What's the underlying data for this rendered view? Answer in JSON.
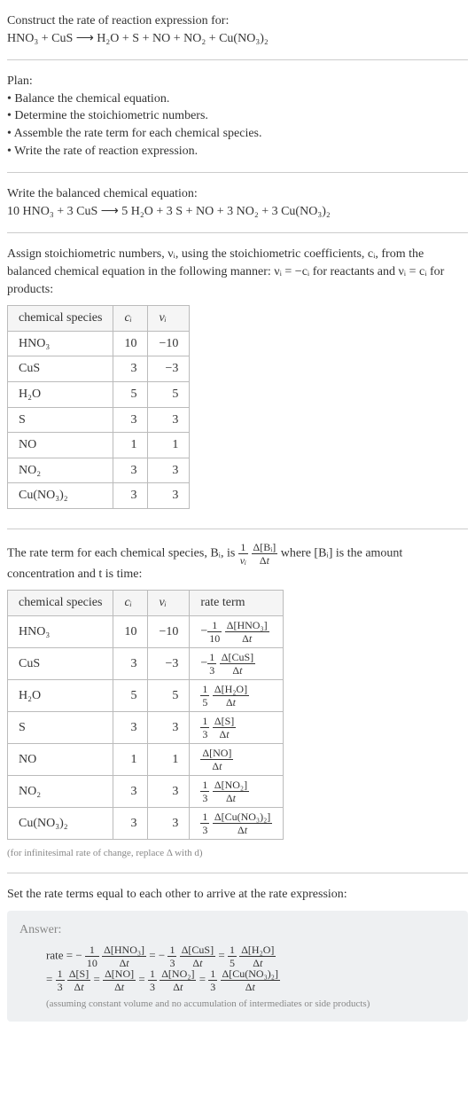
{
  "header": {
    "title": "Construct the rate of reaction expression for:",
    "equation": "HNO₃ + CuS ⟶ H₂O + S + NO + NO₂ + Cu(NO₃)₂"
  },
  "plan": {
    "title": "Plan:",
    "steps": [
      "• Balance the chemical equation.",
      "• Determine the stoichiometric numbers.",
      "• Assemble the rate term for each chemical species.",
      "• Write the rate of reaction expression."
    ]
  },
  "balanced": {
    "title": "Write the balanced chemical equation:",
    "equation": "10 HNO₃ + 3 CuS ⟶ 5 H₂O + 3 S + NO + 3 NO₂ + 3 Cu(NO₃)₂"
  },
  "stoich": {
    "intro": "Assign stoichiometric numbers, νᵢ, using the stoichiometric coefficients, cᵢ, from the balanced chemical equation in the following manner: νᵢ = −cᵢ for reactants and νᵢ = cᵢ for products:",
    "headers": [
      "chemical species",
      "cᵢ",
      "νᵢ"
    ],
    "rows": [
      {
        "species": "HNO₃",
        "c": "10",
        "v": "−10"
      },
      {
        "species": "CuS",
        "c": "3",
        "v": "−3"
      },
      {
        "species": "H₂O",
        "c": "5",
        "v": "5"
      },
      {
        "species": "S",
        "c": "3",
        "v": "3"
      },
      {
        "species": "NO",
        "c": "1",
        "v": "1"
      },
      {
        "species": "NO₂",
        "c": "3",
        "v": "3"
      },
      {
        "species": "Cu(NO₃)₂",
        "c": "3",
        "v": "3"
      }
    ]
  },
  "rateterm": {
    "intro_prefix": "The rate term for each chemical species, Bᵢ, is ",
    "intro_suffix": " where [Bᵢ] is the amount concentration and t is time:",
    "headers": [
      "chemical species",
      "cᵢ",
      "νᵢ",
      "rate term"
    ],
    "rows": [
      {
        "species": "HNO₃",
        "c": "10",
        "v": "−10",
        "term_coef": "−1/10",
        "term_delta": "Δ[HNO₃]"
      },
      {
        "species": "CuS",
        "c": "3",
        "v": "−3",
        "term_coef": "−1/3",
        "term_delta": "Δ[CuS]"
      },
      {
        "species": "H₂O",
        "c": "5",
        "v": "5",
        "term_coef": "1/5",
        "term_delta": "Δ[H₂O]"
      },
      {
        "species": "S",
        "c": "3",
        "v": "3",
        "term_coef": "1/3",
        "term_delta": "Δ[S]"
      },
      {
        "species": "NO",
        "c": "1",
        "v": "1",
        "term_coef": "",
        "term_delta": "Δ[NO]"
      },
      {
        "species": "NO₂",
        "c": "3",
        "v": "3",
        "term_coef": "1/3",
        "term_delta": "Δ[NO₂]"
      },
      {
        "species": "Cu(NO₃)₂",
        "c": "3",
        "v": "3",
        "term_coef": "1/3",
        "term_delta": "Δ[Cu(NO₃)₂]"
      }
    ],
    "note": "(for infinitesimal rate of change, replace Δ with d)"
  },
  "final": {
    "intro": "Set the rate terms equal to each other to arrive at the rate expression:",
    "answer_label": "Answer:",
    "rate_prefix": "rate = ",
    "terms": [
      {
        "sign": "−",
        "coef_top": "1",
        "coef_bot": "10",
        "delta": "Δ[HNO₃]"
      },
      {
        "sign": "−",
        "coef_top": "1",
        "coef_bot": "3",
        "delta": "Δ[CuS]"
      },
      {
        "sign": "",
        "coef_top": "1",
        "coef_bot": "5",
        "delta": "Δ[H₂O]"
      },
      {
        "sign": "",
        "coef_top": "1",
        "coef_bot": "3",
        "delta": "Δ[S]"
      },
      {
        "sign": "",
        "coef_top": "",
        "coef_bot": "",
        "delta": "Δ[NO]"
      },
      {
        "sign": "",
        "coef_top": "1",
        "coef_bot": "3",
        "delta": "Δ[NO₂]"
      },
      {
        "sign": "",
        "coef_top": "1",
        "coef_bot": "3",
        "delta": "Δ[Cu(NO₃)₂]"
      }
    ],
    "note": "(assuming constant volume and no accumulation of intermediates or side products)"
  }
}
